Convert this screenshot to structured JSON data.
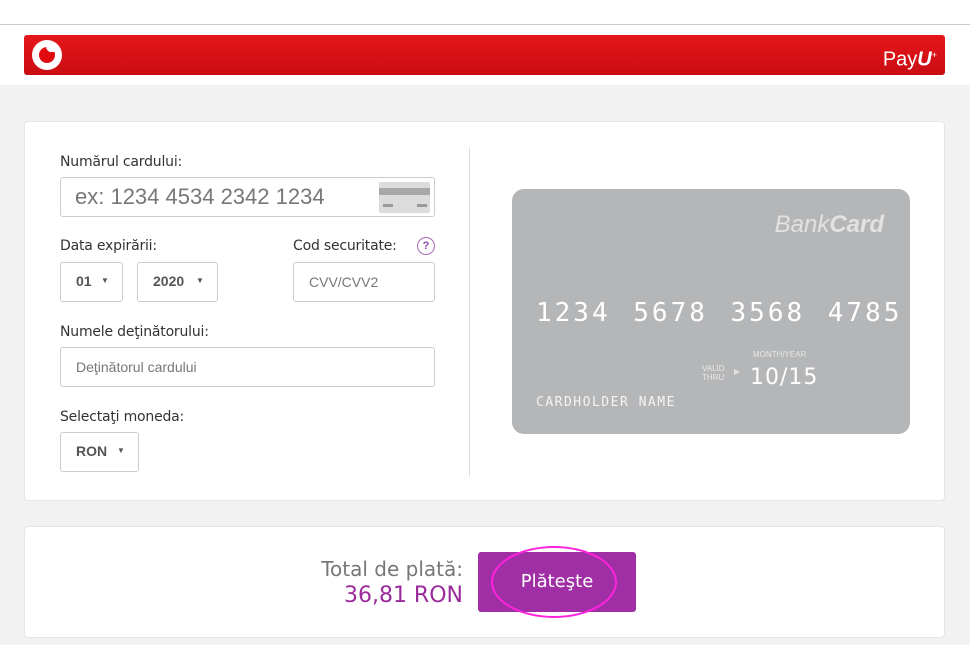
{
  "header": {
    "brand_logo": "vodafone-logo-icon",
    "payu_text": "Pay",
    "payu_bold": "U",
    "payu_mark": "+"
  },
  "form": {
    "card_number_label": "Numărul cardului:",
    "card_number_placeholder": "ex: 1234 4534 2342 1234",
    "expiry_label": "Data expirării:",
    "expiry_month": "01",
    "expiry_year": "2020",
    "security_label": "Cod securitate:",
    "security_help": "?",
    "cvv_placeholder": "CVV/CVV2",
    "holder_label": "Numele deţinătorului:",
    "holder_placeholder": "Deţinătorul cardului",
    "currency_label": "Selectaţi moneda:",
    "currency_value": "RON",
    "caret": "▼"
  },
  "card_preview": {
    "brand_light": "Bank",
    "brand_bold": "Card",
    "number": "1234 5678 3568 4785",
    "valid_line1": "VALID",
    "valid_line2": "THRU",
    "arrow": "▶",
    "month_year_label": "MONTH/YEAR",
    "expiry": "10/15",
    "holder": "CARDHOLDER NAME"
  },
  "payment": {
    "total_label": "Total de plată:",
    "total_amount": "36,81 RON",
    "pay_button": "Plăteşte"
  },
  "colors": {
    "header_red": "#e00a0f",
    "accent_purple": "#a02fa6",
    "highlight_magenta": "#ff22dd",
    "card_gray": "#b5b6b8"
  }
}
